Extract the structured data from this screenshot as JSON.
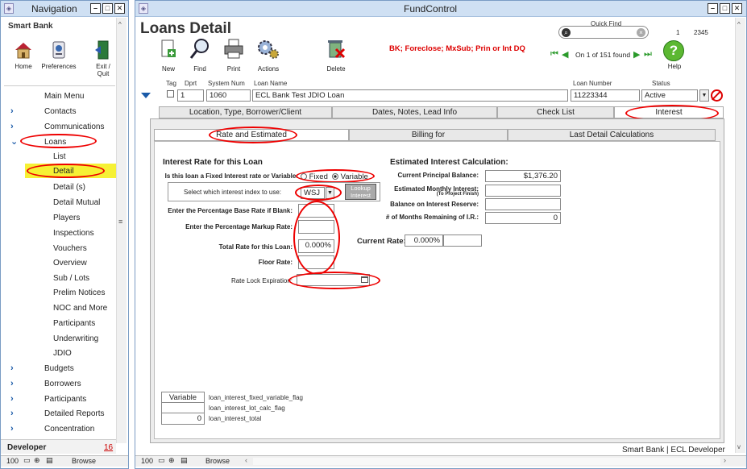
{
  "nav": {
    "title": "Navigation",
    "bank": "Smart Bank",
    "toolbar": {
      "home": "Home",
      "preferences": "Preferences",
      "exit": "Exit /\nQuit"
    },
    "items": {
      "main_menu": "Main Menu",
      "contacts": "Contacts",
      "communications": "Communications",
      "loans": "Loans",
      "loans_sub": [
        "List",
        "Detail",
        "Detail (s)",
        "Detail Mutual",
        "Players",
        "Inspections",
        "Vouchers",
        "Overview",
        "Sub / Lots",
        "Prelim Notices",
        "NOC and More",
        "Participants",
        "Underwriting",
        "JDIO"
      ],
      "budgets": "Budgets",
      "borrowers": "Borrowers",
      "participants": "Participants",
      "detailed_reports": "Detailed Reports",
      "concentration": "Concentration"
    },
    "developer": "Developer",
    "developer_count": "16",
    "zoom": "100",
    "mode": "Browse"
  },
  "main": {
    "title": "FundControl",
    "page_title": "Loans Detail",
    "toolbar": {
      "new": "New",
      "find": "Find",
      "print": "Print",
      "actions": "Actions",
      "delete": "Delete",
      "help": "Help"
    },
    "alert": "BK; Foreclose; MxSub; Prin or Int DQ",
    "quick_find": {
      "label": "Quick Find",
      "value": ""
    },
    "record_num": "1",
    "record_id": "2345",
    "nav_found": "On 1 of 151 found",
    "header_labels": {
      "tag": "Tag",
      "dprt": "Dprt",
      "system_num": "System Num",
      "loan_name": "Loan Name",
      "loan_number": "Loan Number",
      "status": "Status"
    },
    "header_values": {
      "dprt": "1",
      "system_num": "1060",
      "loan_name": "ECL Bank Test JDIO Loan",
      "loan_number": "11223344",
      "status": "Active"
    },
    "tabs": [
      "Location, Type, Borrower/Client",
      "Dates, Notes, Lead Info",
      "Check List",
      "Interest"
    ],
    "subtabs": [
      "Rate and Estimated",
      "Billing for",
      "Last Detail Calculations"
    ],
    "interest": {
      "section_title": "Interest Rate for this Loan",
      "fixed_variable_label": "Is this loan a Fixed Interest rate or Variable:",
      "fixed": "Fixed",
      "variable": "Variable",
      "index_label": "Select which interest index to use:",
      "index_value": "WSJ",
      "lookup": "Lookup Interest",
      "base_rate_label": "Enter the Percentage Base Rate if Blank:",
      "markup_label": "Enter the Percentage Markup Rate:",
      "total_label": "Total Rate for this Loan:",
      "total_value": "0.000%",
      "floor_label": "Floor Rate:",
      "lock_label": "Rate Lock Expiration:"
    },
    "estimated": {
      "section_title": "Estimated Interest Calculation:",
      "principal_label": "Current Principal Balance:",
      "principal_value": "$1,376.20",
      "monthly_label": "Estimated Monthly Interest:",
      "monthly_sub": "(To Project Finish)",
      "reserve_label": "Balance on Interest Reserve:",
      "months_label": "# of Months Remaining of I.R.:",
      "months_value": "0",
      "current_rate_label": "Current Rate:",
      "current_rate_value": "0.000%"
    },
    "debug": [
      {
        "value": "Variable",
        "label": "loan_interest_fixed_variable_flag"
      },
      {
        "value": "",
        "label": "loan_interest_lot_calc_flag"
      },
      {
        "value": "0",
        "label": "loan_interest_total"
      }
    ],
    "footer": "Smart Bank | ECL Developer",
    "zoom": "100",
    "mode": "Browse"
  }
}
